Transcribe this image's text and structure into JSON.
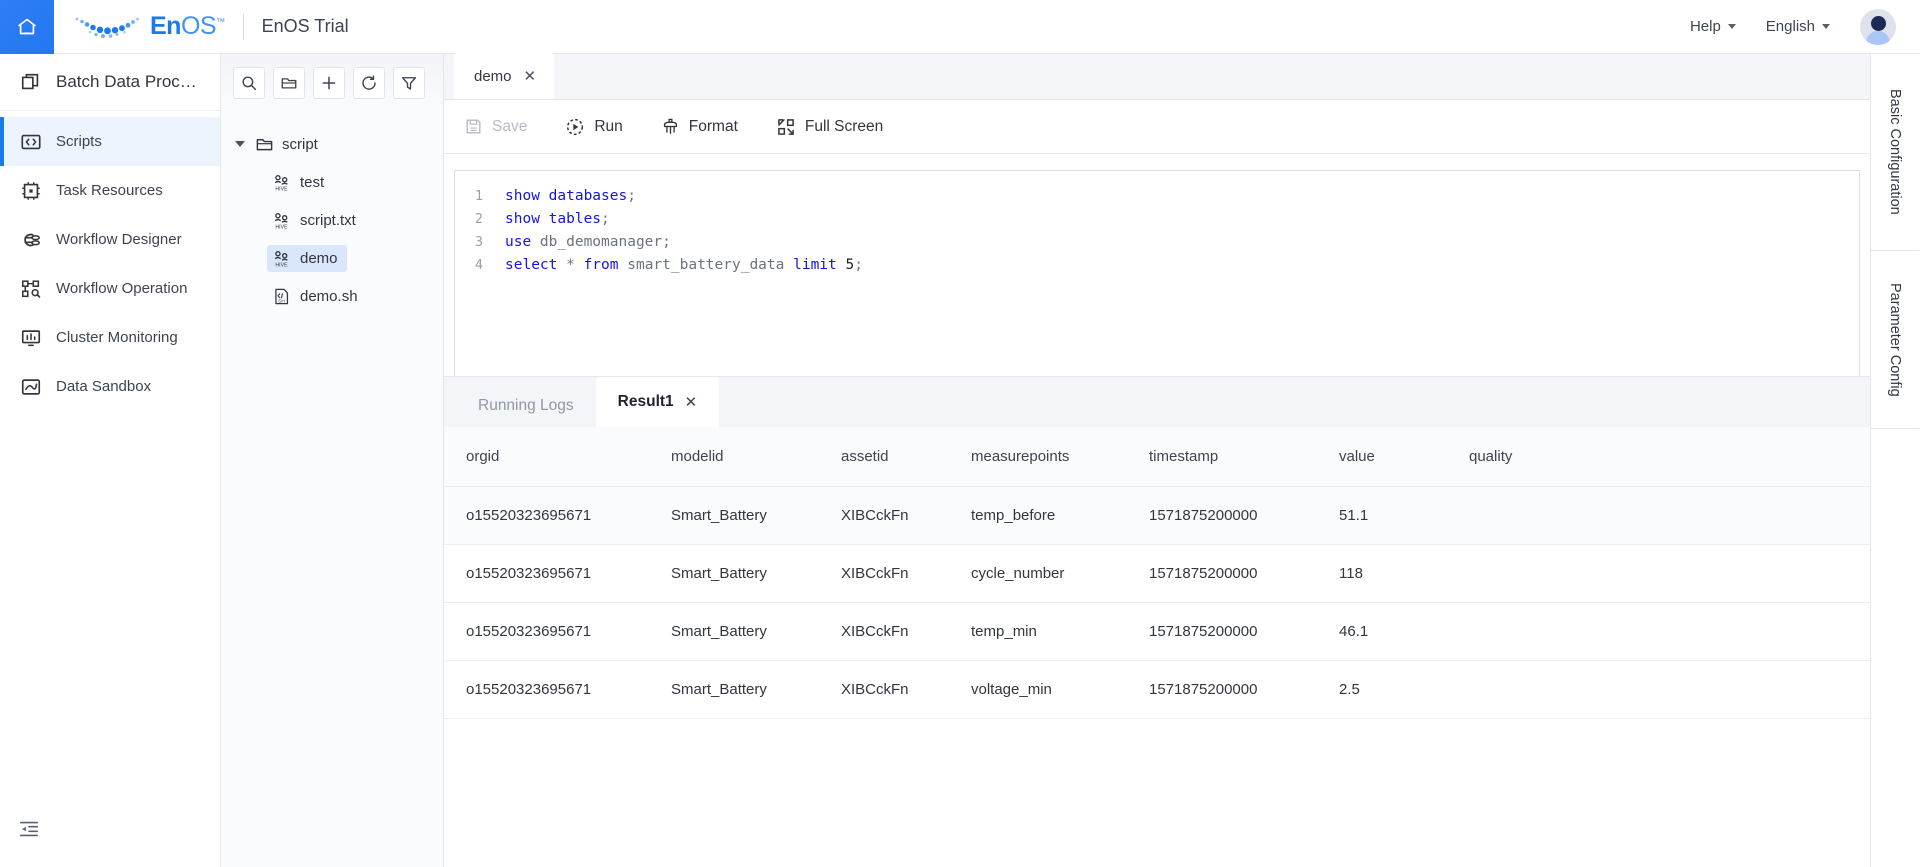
{
  "header": {
    "home_icon": "home-icon",
    "brand": "EnOS",
    "brand_en": "En",
    "brand_os": "OS",
    "brand_tm": "™",
    "title": "EnOS Trial",
    "help_label": "Help",
    "language_label": "English",
    "avatar_icon": "user-avatar-icon"
  },
  "sidebar": {
    "title": "Batch Data Proce…",
    "title_icon": "stacked-squares-icon",
    "items": [
      {
        "label": "Scripts",
        "icon": "code-brackets-icon",
        "active": true
      },
      {
        "label": "Task Resources",
        "icon": "chip-icon",
        "active": false
      },
      {
        "label": "Workflow Designer",
        "icon": "flow-link-icon",
        "active": false
      },
      {
        "label": "Workflow Operation",
        "icon": "flow-nodes-icon",
        "active": false
      },
      {
        "label": "Cluster Monitoring",
        "icon": "monitor-chart-icon",
        "active": false
      },
      {
        "label": "Data Sandbox",
        "icon": "sandbox-chart-icon",
        "active": false
      }
    ],
    "collapse_icon": "collapse-panel-icon"
  },
  "tree": {
    "toolbar": [
      {
        "icon": "search-icon",
        "name": "search-button"
      },
      {
        "icon": "new-folder-icon",
        "name": "new-folder-button"
      },
      {
        "icon": "plus-icon",
        "name": "add-button"
      },
      {
        "icon": "refresh-icon",
        "name": "refresh-button"
      },
      {
        "icon": "filter-funnel-icon",
        "name": "filter-button"
      }
    ],
    "root": {
      "label": "script",
      "icon": "folder-icon",
      "expanded": true
    },
    "files": [
      {
        "label": "test",
        "icon": "hive-file-icon",
        "selected": false
      },
      {
        "label": "script.txt",
        "icon": "hive-file-icon",
        "selected": false
      },
      {
        "label": "demo",
        "icon": "hive-file-icon",
        "selected": true
      },
      {
        "label": "demo.sh",
        "icon": "shell-file-icon",
        "selected": false
      }
    ]
  },
  "editor": {
    "tab": {
      "label": "demo",
      "close": "✕"
    },
    "actions": [
      {
        "label": "Save",
        "icon": "save-disk-icon",
        "disabled": true
      },
      {
        "label": "Run",
        "icon": "play-circle-icon",
        "disabled": false
      },
      {
        "label": "Format",
        "icon": "brush-icon",
        "disabled": false
      },
      {
        "label": "Full Screen",
        "icon": "fullscreen-expand-icon",
        "disabled": false
      }
    ],
    "code_lines": [
      {
        "n": "1",
        "tokens": [
          {
            "t": "show ",
            "c": "kw"
          },
          {
            "t": "databases",
            "c": "kw"
          },
          {
            "t": ";",
            "c": "pn"
          }
        ]
      },
      {
        "n": "2",
        "tokens": [
          {
            "t": "show ",
            "c": "kw"
          },
          {
            "t": "tables",
            "c": "kw"
          },
          {
            "t": ";",
            "c": "pn"
          }
        ]
      },
      {
        "n": "3",
        "tokens": [
          {
            "t": "use ",
            "c": "kw"
          },
          {
            "t": "db_demomanager;",
            "c": "nm"
          }
        ]
      },
      {
        "n": "4",
        "tokens": [
          {
            "t": "select ",
            "c": "kw"
          },
          {
            "t": "* ",
            "c": "nm"
          },
          {
            "t": "from ",
            "c": "kw"
          },
          {
            "t": "smart_battery_data ",
            "c": "nm"
          },
          {
            "t": "limit ",
            "c": "kw"
          },
          {
            "t": "5",
            "c": "num"
          },
          {
            "t": ";",
            "c": "pn"
          }
        ]
      }
    ]
  },
  "result": {
    "tabs": [
      {
        "label": "Running Logs",
        "active": false,
        "closable": false
      },
      {
        "label": "Result1",
        "active": true,
        "closable": true,
        "close": "✕"
      }
    ],
    "columns": [
      "orgid",
      "modelid",
      "assetid",
      "measurepoints",
      "timestamp",
      "value",
      "quality"
    ],
    "rows": [
      {
        "orgid": "o15520323695671",
        "modelid": "Smart_Battery",
        "assetid": "XIBCckFn",
        "measurepoints": "temp_before",
        "timestamp": "1571875200000",
        "value": "51.1",
        "quality": ""
      },
      {
        "orgid": "o15520323695671",
        "modelid": "Smart_Battery",
        "assetid": "XIBCckFn",
        "measurepoints": "cycle_number",
        "timestamp": "1571875200000",
        "value": "118",
        "quality": ""
      },
      {
        "orgid": "o15520323695671",
        "modelid": "Smart_Battery",
        "assetid": "XIBCckFn",
        "measurepoints": "temp_min",
        "timestamp": "1571875200000",
        "value": "46.1",
        "quality": ""
      },
      {
        "orgid": "o15520323695671",
        "modelid": "Smart_Battery",
        "assetid": "XIBCckFn",
        "measurepoints": "voltage_min",
        "timestamp": "1571875200000",
        "value": "2.5",
        "quality": ""
      }
    ]
  },
  "right_rail": {
    "tabs": [
      {
        "label": "Basic Configuration"
      },
      {
        "label": "Parameter Config"
      }
    ]
  },
  "colors": {
    "accent": "#1a7aeb",
    "home_blue": "#2f7df6",
    "keyword_blue": "#1414e0",
    "selected_row": "#d9e6fb",
    "active_nav_bg": "#eef4fe"
  }
}
